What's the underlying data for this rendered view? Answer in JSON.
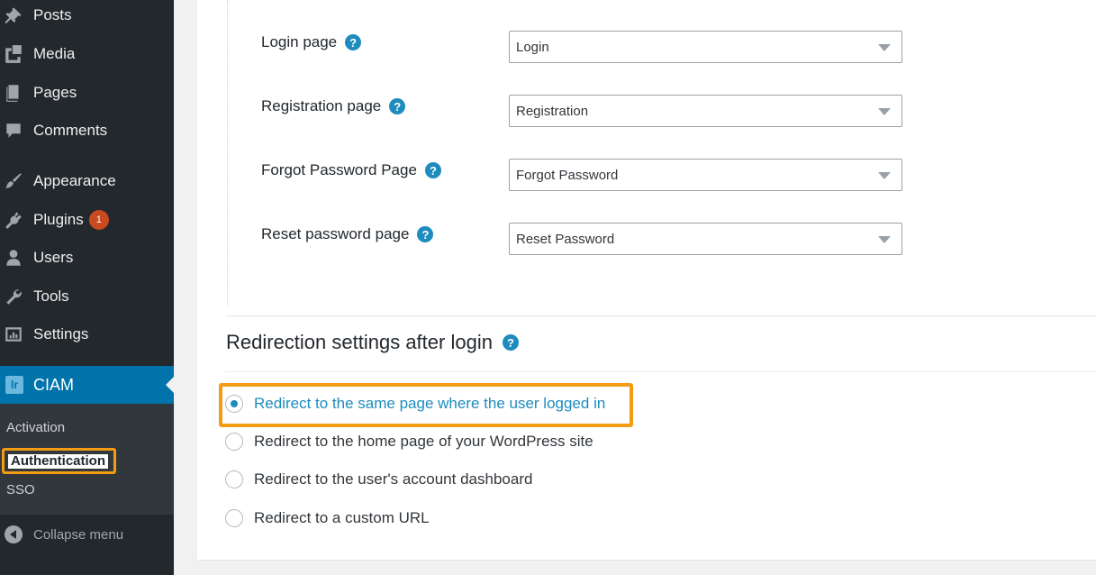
{
  "sidebar": {
    "items": [
      {
        "label": "Posts",
        "icon": "pin-icon"
      },
      {
        "label": "Media",
        "icon": "media-icon"
      },
      {
        "label": "Pages",
        "icon": "pages-icon"
      },
      {
        "label": "Comments",
        "icon": "comment-icon"
      },
      {
        "label": "Appearance",
        "icon": "brush-icon"
      },
      {
        "label": "Plugins",
        "icon": "plugin-icon",
        "badge": "1"
      },
      {
        "label": "Users",
        "icon": "user-icon"
      },
      {
        "label": "Tools",
        "icon": "wrench-icon"
      },
      {
        "label": "Settings",
        "icon": "settings-icon"
      }
    ],
    "active": {
      "label": "CIAM",
      "icon_text": "lr"
    },
    "submenu": [
      "Activation",
      "Authentication",
      "SSO"
    ],
    "collapse_label": "Collapse menu"
  },
  "fields": [
    {
      "label": "Login page",
      "value": "Login"
    },
    {
      "label": "Registration page",
      "value": "Registration"
    },
    {
      "label": "Forgot Password Page",
      "value": "Forgot Password"
    },
    {
      "label": "Reset password page",
      "value": "Reset Password"
    }
  ],
  "help_glyph": "?",
  "redirect": {
    "title": "Redirection settings after login",
    "options": [
      "Redirect to the same page where the user logged in",
      "Redirect to the home page of your WordPress site",
      "Redirect to the user's account dashboard",
      "Redirect to a custom URL"
    ],
    "selected_index": 0
  },
  "colors": {
    "sidebar_bg": "#23282d",
    "active_bg": "#0073aa",
    "highlight": "#f39c12",
    "link": "#1e8cbe",
    "badge": "#ca4a1f"
  }
}
